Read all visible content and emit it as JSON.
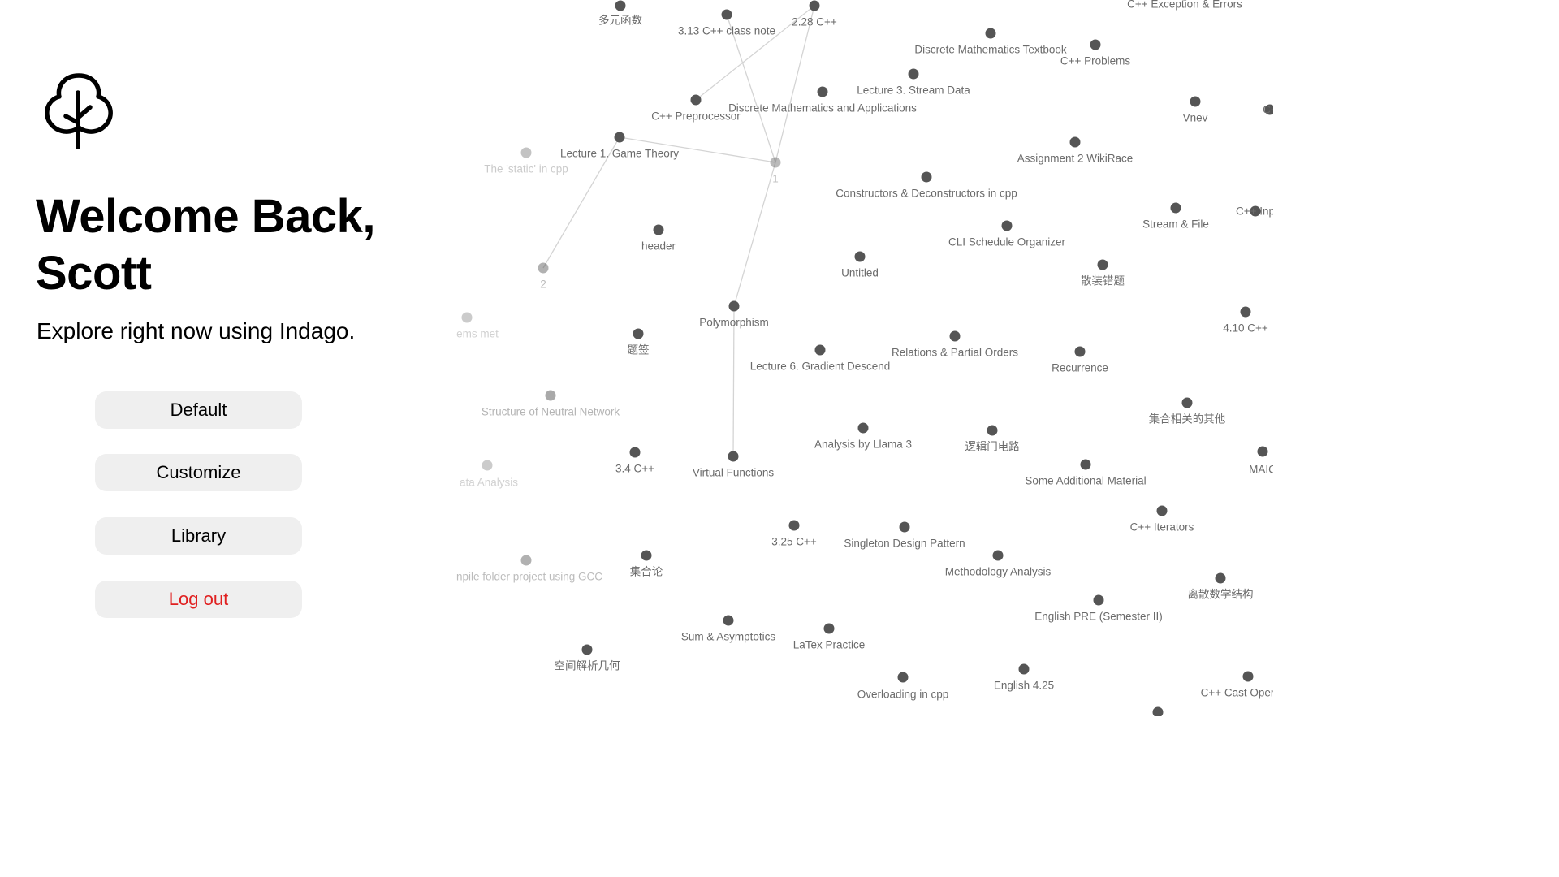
{
  "welcome": {
    "line1": "Welcome Back,",
    "line2": "Scott"
  },
  "subtitle": "Explore right now using Indago.",
  "menu": {
    "default_label": "Default",
    "customize_label": "Customize",
    "library_label": "Library",
    "logout_label": "Log out"
  },
  "colors": {
    "logout": "#e02020",
    "button_bg": "#efefef",
    "node": "#555555",
    "label": "#6b6b6b"
  },
  "icons": {
    "logo": "tree-icon"
  },
  "graph": {
    "nodes": [
      {
        "label": "多元函数"
      },
      {
        "label": "3.13 C++ class note"
      },
      {
        "label": "2.28 C++"
      },
      {
        "label": "C++ Exception & Errors"
      },
      {
        "label": "Discrete Mathematics Textbook"
      },
      {
        "label": "C++ Problems"
      },
      {
        "label": "Lecture 3. Stream Data"
      },
      {
        "label": "Discrete Mathematics and Applications"
      },
      {
        "label": "C++ Preprocessor"
      },
      {
        "label": "Vnev"
      },
      {
        "label": "C+"
      },
      {
        "label": "Lecture 1. Game Theory"
      },
      {
        "label": "The 'static' in cpp"
      },
      {
        "label": "1"
      },
      {
        "label": "Assignment 2 WikiRace"
      },
      {
        "label": "Constructors & Deconstructors in cpp"
      },
      {
        "label": "Stream & File"
      },
      {
        "label": "C++ Inp"
      },
      {
        "label": "header"
      },
      {
        "label": "CLI Schedule Organizer"
      },
      {
        "label": "2"
      },
      {
        "label": "Untitled"
      },
      {
        "label": "散装错题"
      },
      {
        "label": "ems met"
      },
      {
        "label": "Polymorphism"
      },
      {
        "label": "4.10 C++"
      },
      {
        "label": "题签"
      },
      {
        "label": "Relations & Partial Orders"
      },
      {
        "label": "Lecture 6. Gradient Descend"
      },
      {
        "label": "Recurrence"
      },
      {
        "label": "Structure of Neutral Network"
      },
      {
        "label": "集合相关的其他"
      },
      {
        "label": "Analysis by Llama 3"
      },
      {
        "label": "逻辑门电路"
      },
      {
        "label": "3.4 C++"
      },
      {
        "label": "Virtual Functions"
      },
      {
        "label": "ata Analysis"
      },
      {
        "label": "Some Additional Material"
      },
      {
        "label": "MAIC"
      },
      {
        "label": "C++ Iterators"
      },
      {
        "label": "3.25 C++"
      },
      {
        "label": "Singleton Design Pattern"
      },
      {
        "label": "npile folder project using GCC"
      },
      {
        "label": "集合论"
      },
      {
        "label": "Methodology Analysis"
      },
      {
        "label": "离散数学结构"
      },
      {
        "label": "English PRE (Semester II)"
      },
      {
        "label": "Sum & Asymptotics"
      },
      {
        "label": "LaTex Practice"
      },
      {
        "label": "空间解析几何"
      },
      {
        "label": "English 4.25"
      },
      {
        "label": "Overloading in cpp"
      },
      {
        "label": "C++ Cast Oper"
      },
      {
        "label": ""
      }
    ]
  }
}
